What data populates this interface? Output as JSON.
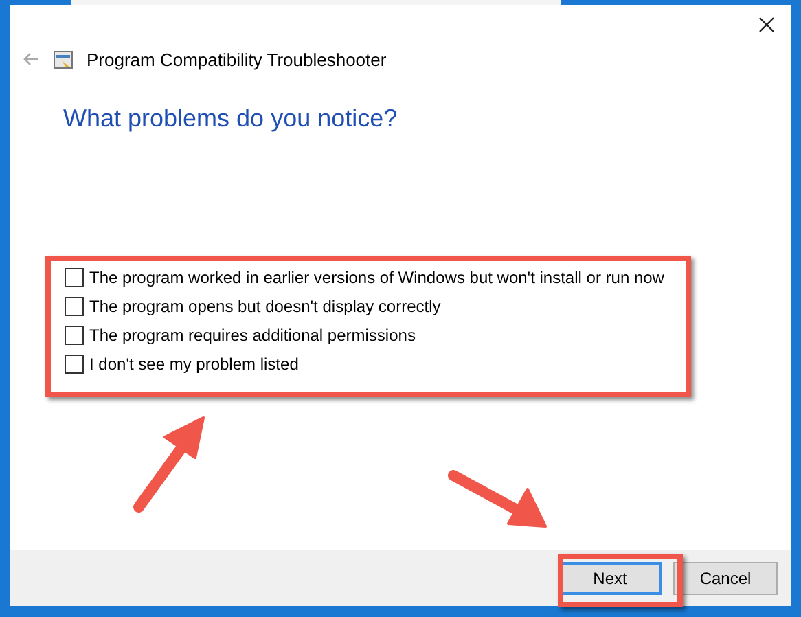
{
  "window": {
    "title": "Program Compatibility Troubleshooter"
  },
  "heading": "What problems do you notice?",
  "options": [
    {
      "label": "The program worked in earlier versions of Windows but won't install or run now",
      "checked": false
    },
    {
      "label": "The program opens but doesn't display correctly",
      "checked": false
    },
    {
      "label": "The program requires additional permissions",
      "checked": false
    },
    {
      "label": "I don't see my problem listed",
      "checked": false
    }
  ],
  "buttons": [
    {
      "label": "Next",
      "highlighted": true
    },
    {
      "label": "Cancel",
      "highlighted": false
    }
  ]
}
